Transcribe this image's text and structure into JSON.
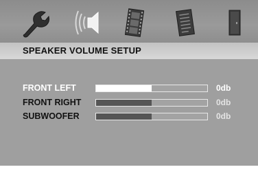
{
  "header": {
    "icons": [
      {
        "name": "wrench-icon",
        "active": false
      },
      {
        "name": "speaker-icon",
        "active": true
      },
      {
        "name": "film-icon",
        "active": false
      },
      {
        "name": "document-icon",
        "active": false
      },
      {
        "name": "door-icon",
        "active": false
      }
    ]
  },
  "title": "SPEAKER VOLUME SETUP",
  "rows": [
    {
      "label": "FRONT LEFT",
      "value": "0db",
      "level": 0.5,
      "selected": true
    },
    {
      "label": "FRONT RIGHT",
      "value": "0db",
      "level": 0.5,
      "selected": false
    },
    {
      "label": "SUBWOOFER",
      "value": "0db",
      "level": 0.5,
      "selected": false
    }
  ],
  "colors": {
    "header_bg": "#939393",
    "content_bg": "#9f9f9f",
    "title_bg": "#cfcfcf",
    "selected_text": "#ffffff",
    "normal_text": "#111111",
    "fill_dark": "#555555"
  }
}
